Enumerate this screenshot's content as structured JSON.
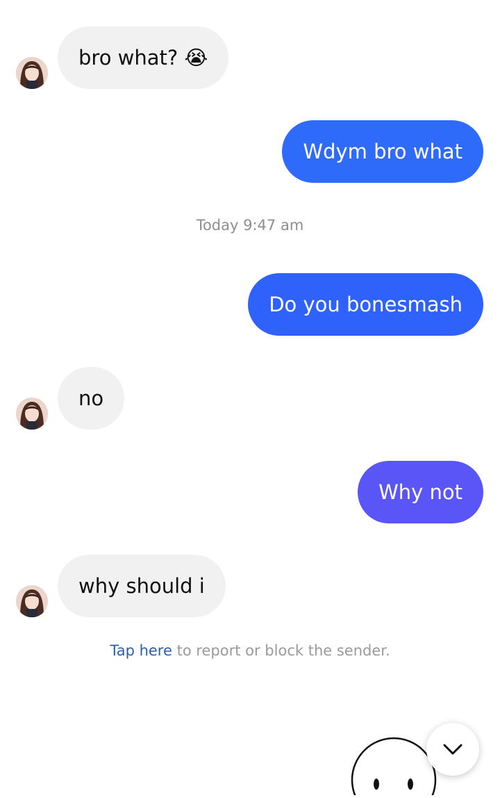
{
  "messages": {
    "m1": {
      "text": "bro what? 😭"
    },
    "m2": {
      "text": "Wdym bro what",
      "color": "#2f6bfa"
    },
    "m3": {
      "text": "Do you bonesmash",
      "color": "#2f62fb"
    },
    "m4": {
      "text": "no"
    },
    "m5": {
      "text": "Why not",
      "color": "#5a55f6"
    },
    "m6": {
      "text": "why should i"
    }
  },
  "timestamp": "Today 9:47 am",
  "report": {
    "link_text": "Tap here",
    "rest_text": " to report or block the sender."
  },
  "icons": {
    "avatar": "profile-avatar-icon",
    "scroll_down": "chevron-down-icon",
    "sticker": "smiley-face-icon"
  },
  "colors": {
    "incoming_bubble": "#f1f1f1",
    "outgoing_bubble_blue": "#2f6bfa",
    "outgoing_bubble_violet": "#5a55f6",
    "link": "#2f5ea9"
  }
}
